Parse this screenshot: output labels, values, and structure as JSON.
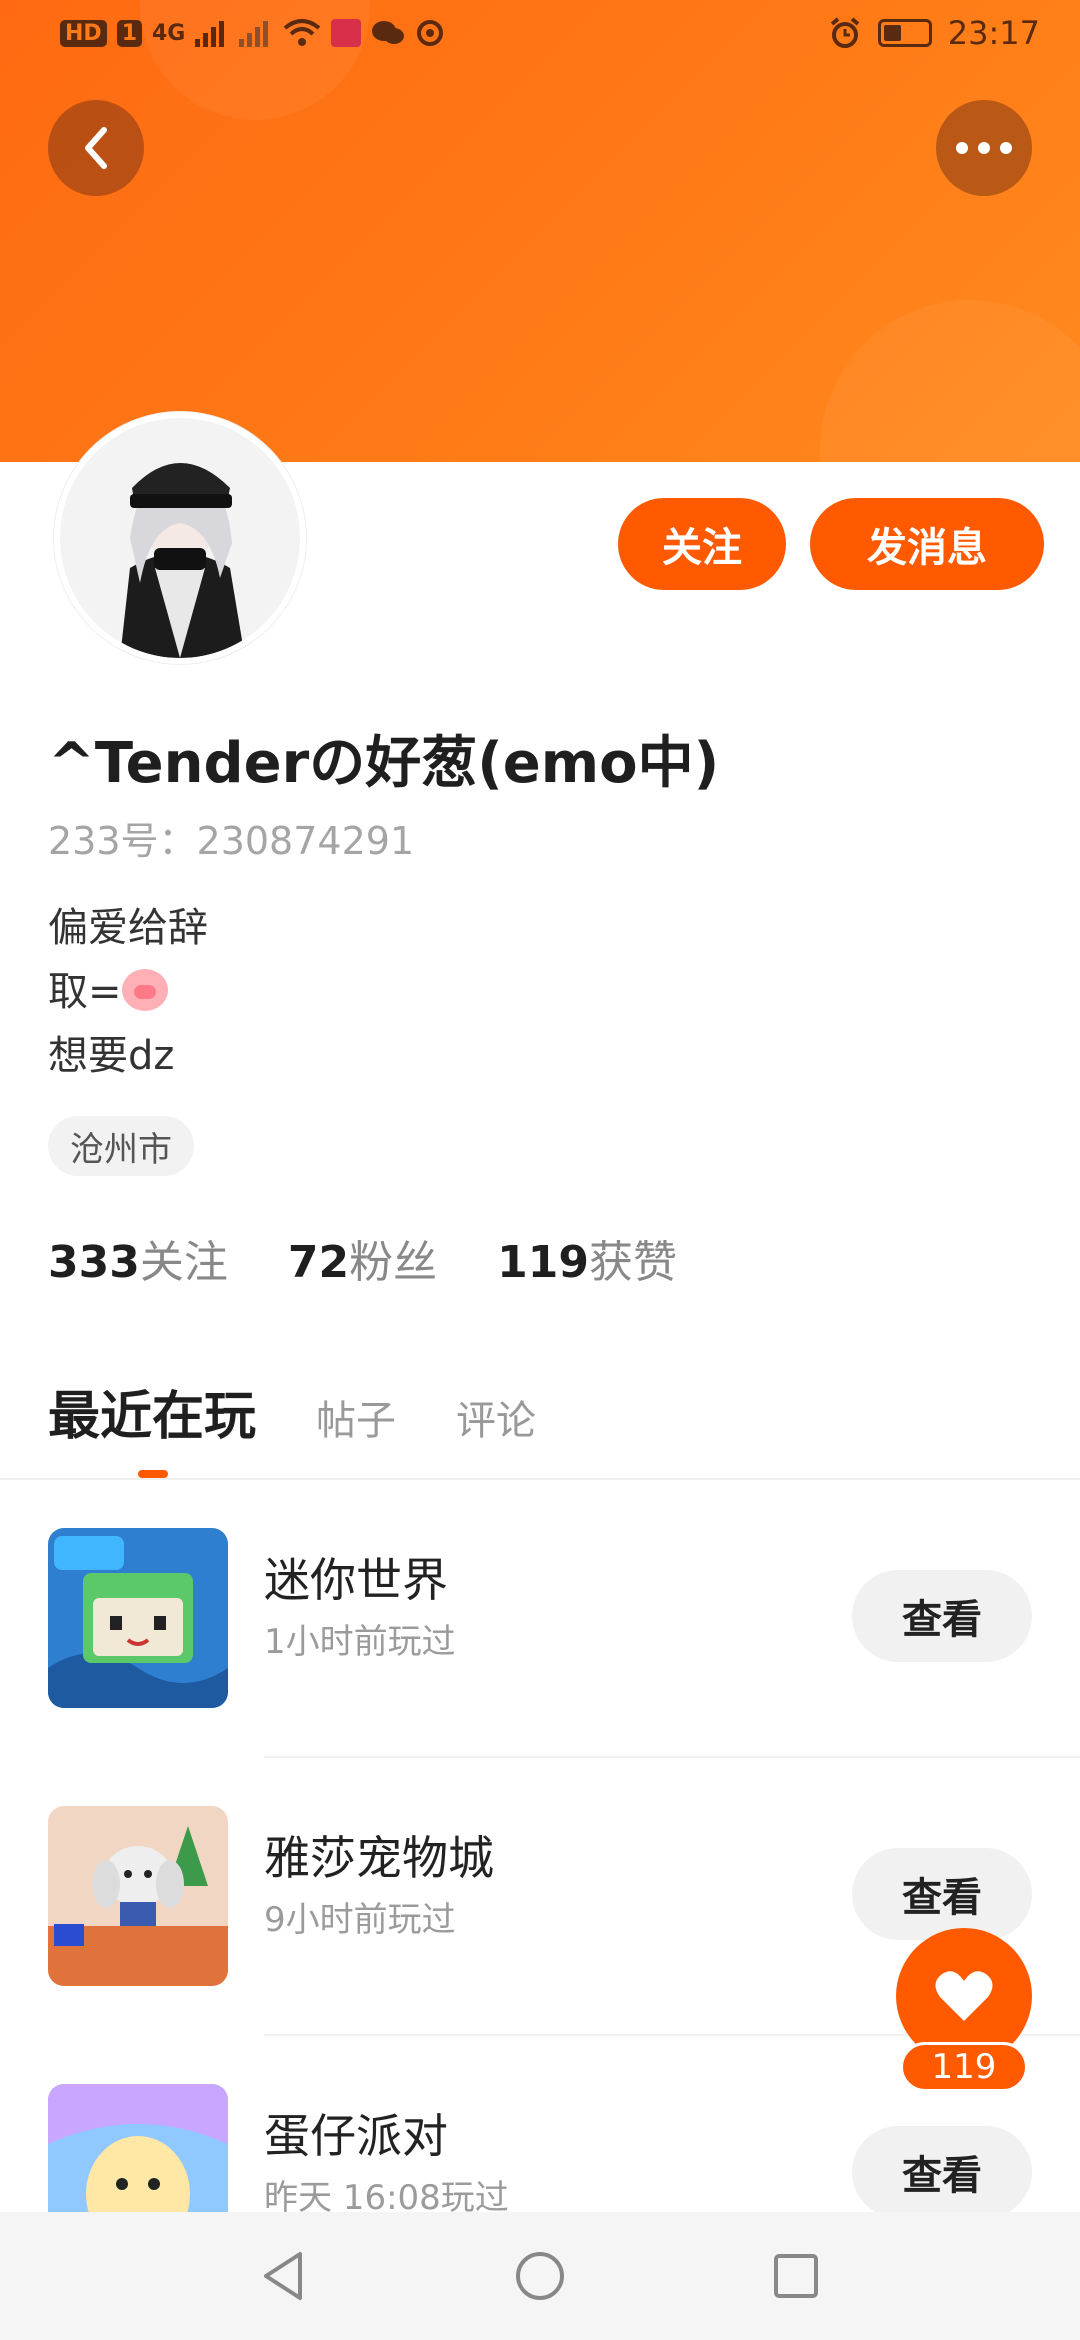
{
  "status_bar": {
    "left_badges": [
      "HD",
      "1",
      "4G"
    ],
    "time": "23:17",
    "battery_level": 0.4,
    "icons": [
      "hd-icon",
      "signal-4g-icon",
      "signal-icon",
      "wifi-icon",
      "app-notification-icon",
      "wechat-icon",
      "location-icon",
      "alarm-icon",
      "battery-icon"
    ]
  },
  "header": {
    "back_icon": "chevron-left-icon",
    "more_icon": "more-dots-icon"
  },
  "actions": {
    "follow_label": "关注",
    "message_label": "发消息"
  },
  "profile": {
    "name": "^Tenderの好葱(emo中)",
    "uid_text": "233号：230874291",
    "bio_lines": [
      "偏爱给辞",
      "取=",
      "想要dz"
    ],
    "bio_emoji": "pig-face-emoji",
    "location": "沧州市"
  },
  "stats": [
    {
      "num": "333",
      "label": "关注"
    },
    {
      "num": "72",
      "label": "粉丝"
    },
    {
      "num": "119",
      "label": "获赞"
    }
  ],
  "tabs": [
    {
      "label": "最近在玩",
      "active": true
    },
    {
      "label": "帖子",
      "active": false
    },
    {
      "label": "评论",
      "active": false
    }
  ],
  "games": [
    {
      "title": "迷你世界",
      "time": "1小时前玩过",
      "button": "查看"
    },
    {
      "title": "雅莎宠物城",
      "time": "9小时前玩过",
      "button": "查看"
    },
    {
      "title": "蛋仔派对",
      "time": "昨天 16:08玩过",
      "button": "查看"
    }
  ],
  "like": {
    "count": "119",
    "icon": "heart-icon"
  },
  "navbar": {
    "icons": [
      "back-triangle-icon",
      "home-circle-icon",
      "recents-square-icon"
    ]
  },
  "colors": {
    "accent": "#ff5a00",
    "banner": "#ff7a16"
  }
}
